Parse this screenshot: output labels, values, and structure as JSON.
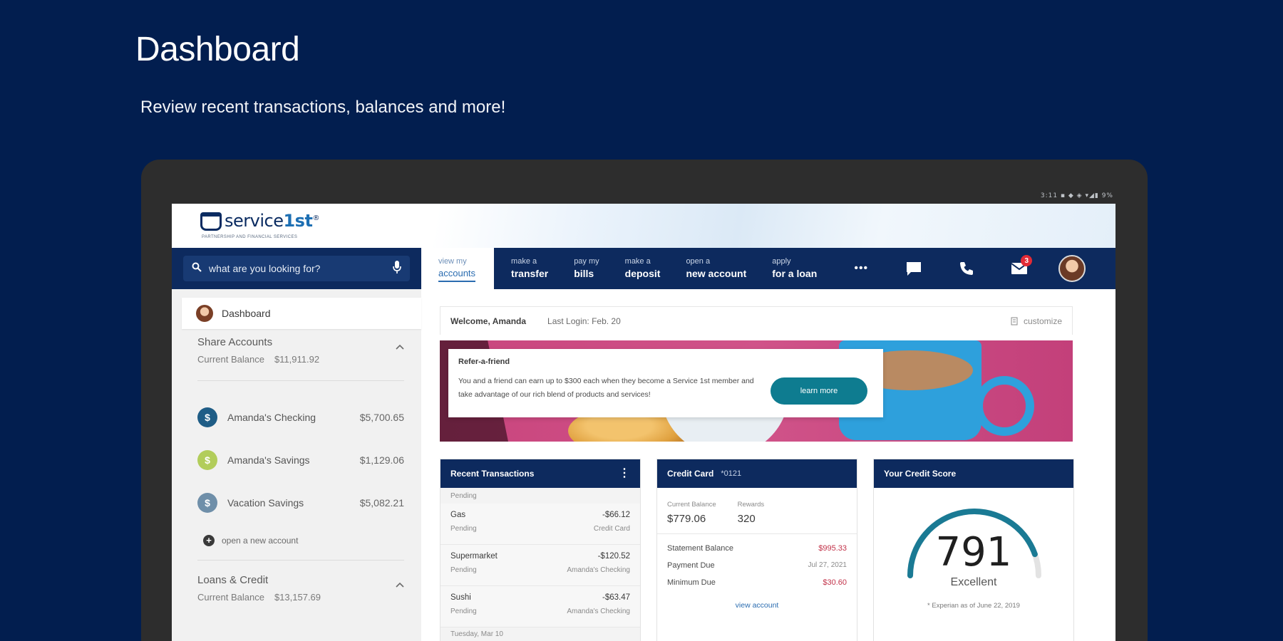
{
  "hero": {
    "title": "Dashboard",
    "subtitle": "Review recent transactions, balances and more!"
  },
  "device": {
    "status_bar": "3:11 ▪ ◆ ◈ ▾◢▮ 9%"
  },
  "brand": {
    "logo_prefix": "service",
    "logo_bold": "1st",
    "logo_mark": "®",
    "tagline": "PARTNERSHIP AND FINANCIAL SERVICES"
  },
  "search": {
    "placeholder": "what are you looking for?",
    "search_icon": "search-icon",
    "mic_icon": "mic-icon"
  },
  "nav": {
    "items": [
      {
        "small": "view my",
        "big": "accounts",
        "active": true
      },
      {
        "small": "make a",
        "big": "transfer"
      },
      {
        "small": "pay my",
        "big": "bills"
      },
      {
        "small": "make a",
        "big": "deposit"
      },
      {
        "small": "open a",
        "big": "new account"
      },
      {
        "small": "apply",
        "big": "for a loan"
      }
    ],
    "more": "•••",
    "mail_badge": "3",
    "icons": [
      "more-icon",
      "chat-icon",
      "phone-icon",
      "mail-icon",
      "avatar"
    ]
  },
  "sidebar": {
    "dashboard_label": "Dashboard",
    "share": {
      "title": "Share Accounts",
      "balance_label": "Current Balance",
      "balance": "$11,911.92"
    },
    "accounts": [
      {
        "name": "Amanda's Checking",
        "amount": "$5,700.65",
        "color": "#1f5d86"
      },
      {
        "name": "Amanda's Savings",
        "amount": "$1,129.06",
        "color": "#b2cd5b"
      },
      {
        "name": "Vacation Savings",
        "amount": "$5,082.21",
        "color": "#6f8fa9"
      }
    ],
    "open_account": "open a new account",
    "loans": {
      "title": "Loans & Credit",
      "balance_label": "Current Balance",
      "balance": "$13,157.69"
    }
  },
  "welcome": {
    "text": "Welcome, Amanda",
    "last_login": "Last Login: Feb. 20",
    "customize": "customize"
  },
  "banner": {
    "title": "Refer-a-friend",
    "body": "You and a friend can earn up to $300 each when they become a Service 1st member and take advantage of our rich blend of products and services!",
    "button": "learn more"
  },
  "transactions": {
    "title": "Recent Transactions",
    "pending_label": "Pending",
    "rows": [
      {
        "name": "Gas",
        "amount": "-$66.12",
        "status": "Pending",
        "account": "Credit Card"
      },
      {
        "name": "Supermarket",
        "amount": "-$120.52",
        "status": "Pending",
        "account": "Amanda's Checking"
      },
      {
        "name": "Sushi",
        "amount": "-$63.47",
        "status": "Pending",
        "account": "Amanda's Checking"
      }
    ],
    "date_label": "Tuesday, Mar 10"
  },
  "credit_card": {
    "title": "Credit Card",
    "mask": "*0121",
    "current_balance_label": "Current Balance",
    "current_balance": "$779.06",
    "rewards_label": "Rewards",
    "rewards": "320",
    "rows": [
      {
        "label": "Statement Balance",
        "value": "$995.33",
        "style": "red"
      },
      {
        "label": "Payment Due",
        "value": "Jul 27, 2021",
        "style": "grey"
      },
      {
        "label": "Minimum Due",
        "value": "$30.60",
        "style": "red"
      }
    ],
    "link": "view account"
  },
  "credit_score": {
    "title": "Your Credit Score",
    "score": "791",
    "rating": "Excellent",
    "as_of": "* Experian as of June 22, 2019",
    "score_value": 791,
    "score_min": 300,
    "score_max": 850
  }
}
